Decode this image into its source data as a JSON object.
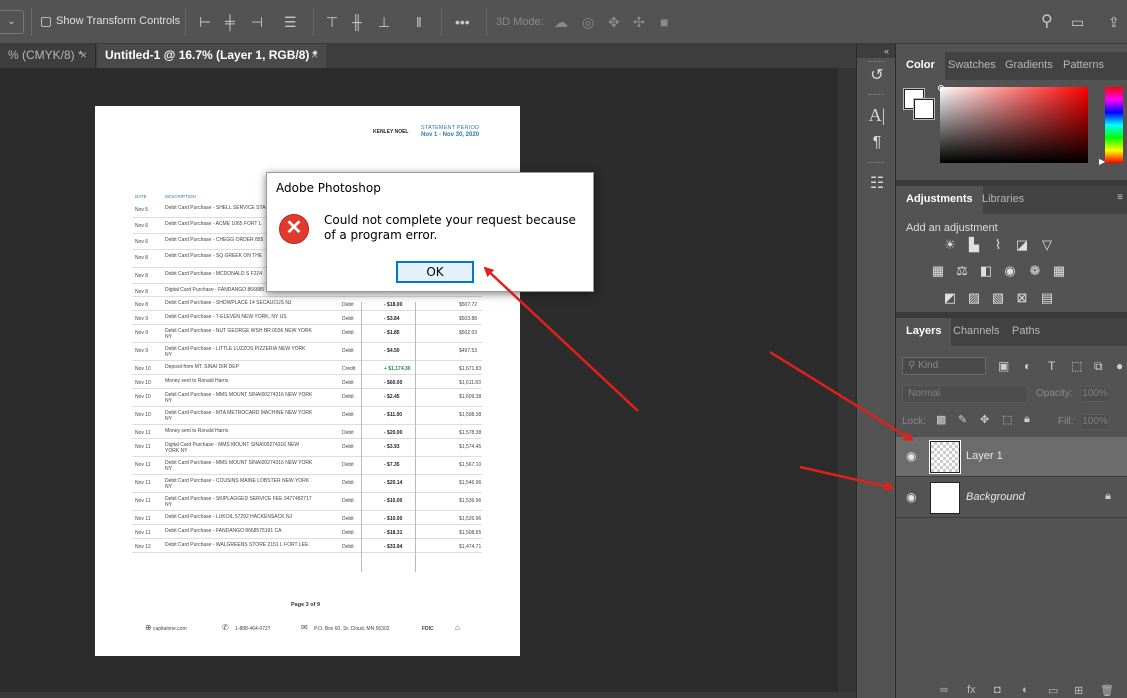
{
  "options_bar": {
    "show_transform_controls": "Show Transform Controls",
    "mode_3d": "3D Mode:",
    "more": "•••"
  },
  "tabs": [
    {
      "label": "% (CMYK/8) *",
      "close": "×"
    },
    {
      "label": "Untitled-1 @ 16.7% (Layer 1, RGB/8) *",
      "close": "×"
    }
  ],
  "document": {
    "name": "KENLEY NOEL",
    "statement_label": "STATEMENT PERIOD",
    "statement_dates": "Nov 1 - Nov 30, 2020",
    "col_date": "DATE",
    "col_description": "DESCRIPTION",
    "rows": [
      {
        "date": "Nov 5",
        "desc": "Debit Card Purchase - SHELL SERVICE STA",
        "type": "",
        "amount": "",
        "balance": ""
      },
      {
        "date": "Nov 6",
        "desc": "Debit Card Purchase - ACME 1065 FORT L",
        "type": "",
        "amount": "",
        "balance": ""
      },
      {
        "date": "Nov 6",
        "desc": "Debit Card Purchase - CHEGG ORDER 855",
        "type": "",
        "amount": "",
        "balance": ""
      },
      {
        "date": "Nov 8",
        "desc": "Debit Card Purchase - SQ GREEK ON THE",
        "type": "",
        "amount": "",
        "balance": ""
      },
      {
        "date": "Nov 8",
        "desc": "Debit Card Purchase - MCDONALD S F224",
        "type": "",
        "amount": "",
        "balance": ""
      },
      {
        "date": "Nov 8",
        "desc": "Digital Card Purchase - FANDANGO 866885",
        "type": "",
        "amount": "",
        "balance": ""
      },
      {
        "date": "Nov 8",
        "desc": "Debit Card Purchase - SHOWPLACE 14 SECAUCUS NJ",
        "type": "Debit",
        "amount": "- $18.00",
        "balance": "$507.72"
      },
      {
        "date": "Nov 9",
        "desc": "Debit Card Purchase - 7-ELEVEN NEW YORK, NY US",
        "type": "Debit",
        "amount": "- $3.84",
        "balance": "$503.88"
      },
      {
        "date": "Nov 9",
        "desc": "Debit Card Purchase - NUT GEORGE WSH BR 0036 NEW YORK NY",
        "type": "Debit",
        "amount": "- $1.85",
        "balance": "$502.03"
      },
      {
        "date": "Nov 9",
        "desc": "Debit Card Purchase - LITTLE LUZZOS PIZZERIA NEW YORK NY",
        "type": "Debit",
        "amount": "- $4.50",
        "balance": "$497.53"
      },
      {
        "date": "Nov 10",
        "desc": "Deposit from MT. SINAI DIR DEP",
        "type": "Credit",
        "amount": "+ $1,174.30",
        "balance": "$1,671.83",
        "credit": true
      },
      {
        "date": "Nov 10",
        "desc": "Money sent to Ronald Harris",
        "type": "Debit",
        "amount": "- $60.00",
        "balance": "$1,611.83"
      },
      {
        "date": "Nov 10",
        "desc": "Debit Card Purchase - MMS MOUNT SINAI00274316 NEW YORK NY",
        "type": "Debit",
        "amount": "- $2.45",
        "balance": "$1,609.38"
      },
      {
        "date": "Nov 10",
        "desc": "Debit Card Purchase - MTA METROCARD MACHINE NEW YORK NY",
        "type": "Debit",
        "amount": "- $11.00",
        "balance": "$1,598.38"
      },
      {
        "date": "Nov 11",
        "desc": "Money sent to Ronald Harris",
        "type": "Debit",
        "amount": "- $20.00",
        "balance": "$1,578.38"
      },
      {
        "date": "Nov 11",
        "desc": "Digital Card Purchase - MMS MOUNT SINAI00274316 NEW YORK NY",
        "type": "Debit",
        "amount": "- $3.93",
        "balance": "$1,574.45"
      },
      {
        "date": "Nov 11",
        "desc": "Debit Card Purchase - MMS MOUNT SINAI00274316 NEW YORK NY",
        "type": "Debit",
        "amount": "- $7.35",
        "balance": "$1,567.10"
      },
      {
        "date": "Nov 11",
        "desc": "Debit Card Purchase - COUSINS MAINE LOBSTER NEW YORK NY",
        "type": "Debit",
        "amount": "- $20.14",
        "balance": "$1,546.96"
      },
      {
        "date": "Nov 11",
        "desc": "Debit Card Purchase - SKIPLAGGED SERVICE FEE 3477482717 NY",
        "type": "Debit",
        "amount": "- $10.00",
        "balance": "$1,536.96"
      },
      {
        "date": "Nov 11",
        "desc": "Debit Card Purchase - LUKOIL 57292 HACKENSACK NJ",
        "type": "Debit",
        "amount": "- $10.00",
        "balance": "$1,526.96"
      },
      {
        "date": "Nov 11",
        "desc": "Debit Card Purchase - FANDANGO 8668575191 CA",
        "type": "Debit",
        "amount": "- $18.31",
        "balance": "$1,508.65"
      },
      {
        "date": "Nov 12",
        "desc": "Debit Card Purchase - WALGREENS STORE 2151 L FORT LEE.",
        "type": "Debit",
        "amount": "- $33.94",
        "balance": "$1,474.71"
      }
    ],
    "page_number": "Page 3 of 9",
    "footer_site": "capitalone.com",
    "footer_phone": "1-888-464-0727",
    "footer_address": "P.O. Box 60, St. Cloud, MN 56302",
    "footer_fdic": "FDIC"
  },
  "dialog": {
    "title": "Adobe Photoshop",
    "message": "Could not complete your request because of a program error.",
    "ok_label": "OK",
    "icon": "error-x-icon"
  },
  "panels": {
    "color_tabs": [
      "Color",
      "Swatches",
      "Gradients",
      "Patterns"
    ],
    "adjust_tabs": [
      "Adjustments",
      "Libraries"
    ],
    "add_adjustment": "Add an adjustment",
    "layer_tabs": [
      "Layers",
      "Channels",
      "Paths"
    ],
    "kind_label": "Kind",
    "blend_mode": "Normal",
    "opacity_label": "Opacity:",
    "opacity_value": "100%",
    "lock_label": "Lock:",
    "fill_label": "Fill:",
    "fill_value": "100%",
    "layers": [
      {
        "name": "Layer 1",
        "selected": true
      },
      {
        "name": "Background",
        "selected": false,
        "locked": true
      }
    ]
  },
  "colors": {
    "accent_blue": "#2a7ab0",
    "arrow_red": "#e0201a",
    "error_red": "#e23a2c"
  }
}
